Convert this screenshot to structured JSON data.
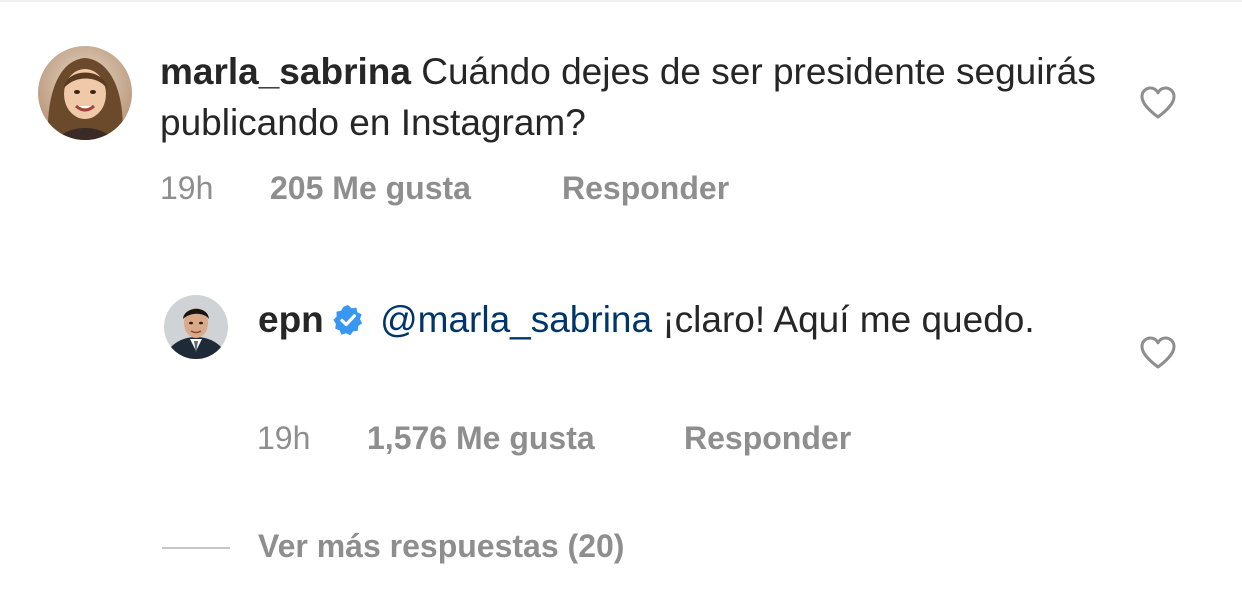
{
  "comments": [
    {
      "username": "marla_sabrina",
      "text": "Cuándo dejes de ser presidente seguirás publicando en Instagram?",
      "time": "19h",
      "likes": "205 Me gusta",
      "reply": "Responder"
    },
    {
      "username": "epn",
      "verified": true,
      "mention": "@marla_sabrina",
      "text": "¡claro! Aquí me quedo.",
      "time": "19h",
      "likes": "1,576 Me gusta",
      "reply": "Responder"
    }
  ],
  "more_replies": "Ver más respuestas (20)",
  "colors": {
    "text": "#262626",
    "secondary": "#8e8e8e",
    "mention": "#003569",
    "verified": "#3897f0",
    "divider": "#c7c7c7"
  },
  "icons": {
    "like": "heart-outline-icon",
    "verified": "verified-badge-icon"
  }
}
